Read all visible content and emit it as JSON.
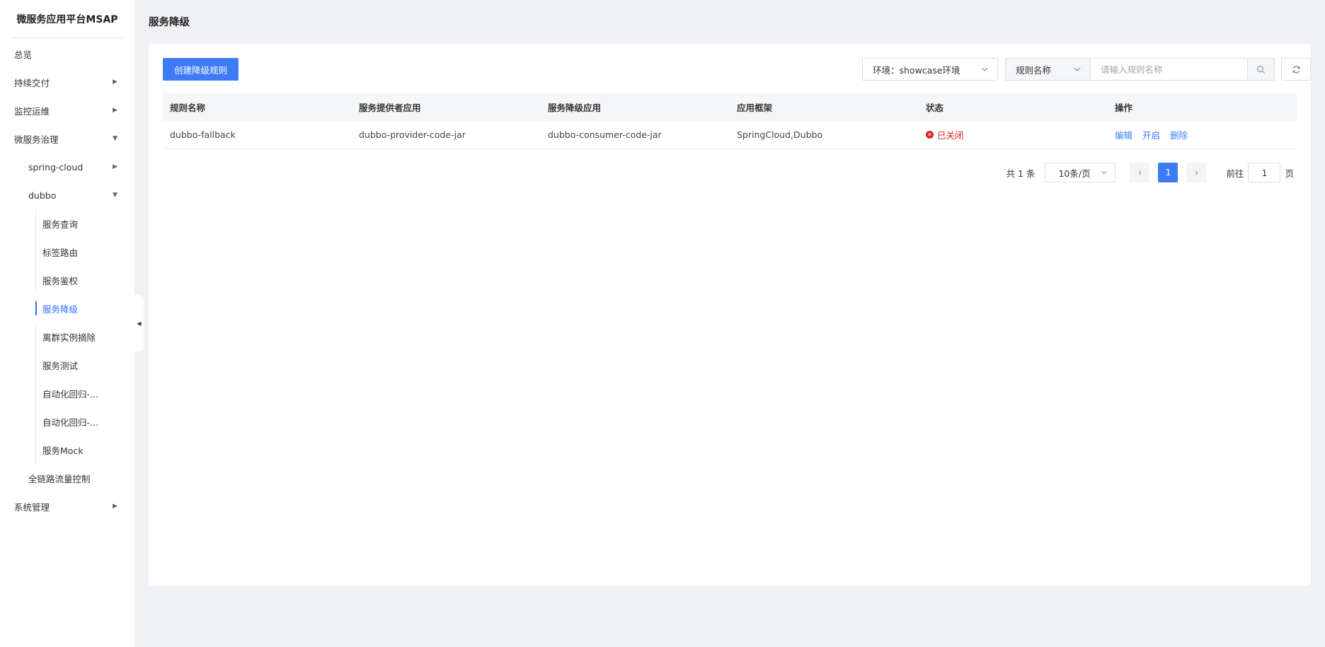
{
  "app": {
    "title": "微服务应用平台MSAP"
  },
  "sidebar": {
    "overview": "总览",
    "cd": "持续交付",
    "ops": "监控运维",
    "governance": "微服务治理",
    "spring_cloud": "spring-cloud",
    "dubbo": "dubbo",
    "dubbo_items": [
      "服务查询",
      "标签路由",
      "服务鉴权",
      "服务降级",
      "离群实例摘除",
      "服务测试",
      "自动化回归-...",
      "自动化回归-...",
      "服务Mock"
    ],
    "full_link": "全链路流量控制",
    "system": "系统管理",
    "active_item": "服务降级"
  },
  "page": {
    "title": "服务降级"
  },
  "toolbar": {
    "create_label": "创建降级规则",
    "env_label": "环境：showcase环境",
    "search_type": "规则名称",
    "search_placeholder": "请输入规则名称"
  },
  "table": {
    "columns": [
      "规则名称",
      "服务提供者应用",
      "服务降级应用",
      "应用框架",
      "状态",
      "操作"
    ],
    "rows": [
      {
        "name": "dubbo-fallback",
        "provider": "dubbo-provider-code-jar",
        "consumer": "dubbo-consumer-code-jar",
        "framework": "SpringCloud,Dubbo",
        "status": "已关闭",
        "actions": [
          "编辑",
          "开启",
          "删除"
        ]
      }
    ]
  },
  "pagination": {
    "total_text": "共 1 条",
    "page_size": "10条/页",
    "current_page": "1",
    "goto_label": "前往",
    "goto_value": "1",
    "page_suffix": "页"
  },
  "colors": {
    "primary": "#3d7bf7",
    "danger": "#e02020",
    "background": "#f0f1f5"
  }
}
